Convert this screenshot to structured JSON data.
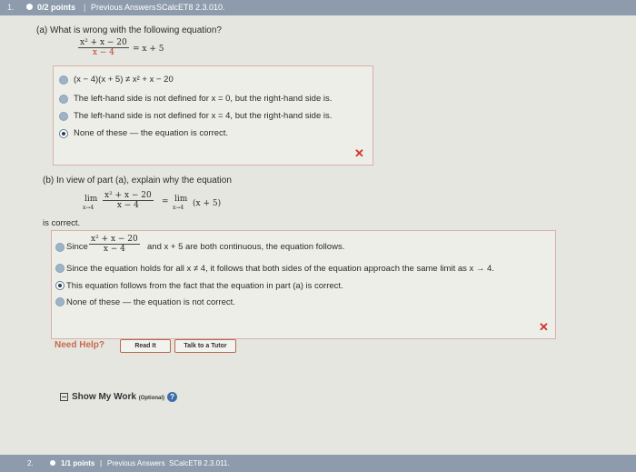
{
  "header": {
    "question_number": "1.",
    "points": "0/2 points",
    "separator": "|",
    "previous_answers": "Previous Answers",
    "problem_code": "SCalcET8 2.3.010."
  },
  "part_a": {
    "prompt": "(a) What is wrong with the following equation?",
    "equation": {
      "num": "x² + x − 20",
      "den": "x − 4",
      "rhs": "= x + 5"
    },
    "options": [
      {
        "text": "(x − 4)(x + 5) ≠ x² + x − 20",
        "selected": false
      },
      {
        "text": "The left-hand side is not defined for x = 0, but the right-hand side is.",
        "selected": false
      },
      {
        "text": "The left-hand side is not defined for x = 4, but the right-hand side is.",
        "selected": false
      },
      {
        "text": "None of these — the equation is correct.",
        "selected": true
      }
    ],
    "result_mark": "✕"
  },
  "part_b": {
    "prompt": "(b) In view of part (a), explain why the equation",
    "equation": {
      "lim_left": "lim",
      "sub_left": "x→4",
      "num": "x² + x − 20",
      "den": "x − 4",
      "eq": "=",
      "lim_right": "lim",
      "sub_right": "x→4",
      "rhs": "(x + 5)"
    },
    "after": "is correct.",
    "options": [
      {
        "prefix": "Since",
        "frac_num": "x² + x − 20",
        "frac_den": "x − 4",
        "text": "and x + 5 are both continuous, the equation follows.",
        "selected": false
      },
      {
        "text": "Since the equation holds for all x ≠ 4, it follows that both sides of the equation approach the same limit as x → 4.",
        "selected": false
      },
      {
        "text": "This equation follows from the fact that the equation in part (a) is correct.",
        "selected": true
      },
      {
        "text": "None of these — the equation is not correct.",
        "selected": false
      }
    ],
    "result_mark": "✕"
  },
  "help": {
    "label": "Need Help?",
    "read_it": "Read It",
    "talk_tutor": "Talk to a Tutor"
  },
  "show_work": {
    "label": "Show My Work",
    "optional": "(Optional)",
    "help_icon": "?"
  },
  "footer": {
    "question_number": "2.",
    "points": "1/1 points",
    "separator": "|",
    "previous_answers": "Previous Answers",
    "problem_code": "SCalcET8 2.3.011."
  },
  "colors": {
    "header_bar": "#8e9bac",
    "incorrect_red": "#d4322a",
    "need_help": "#c86a4a"
  }
}
